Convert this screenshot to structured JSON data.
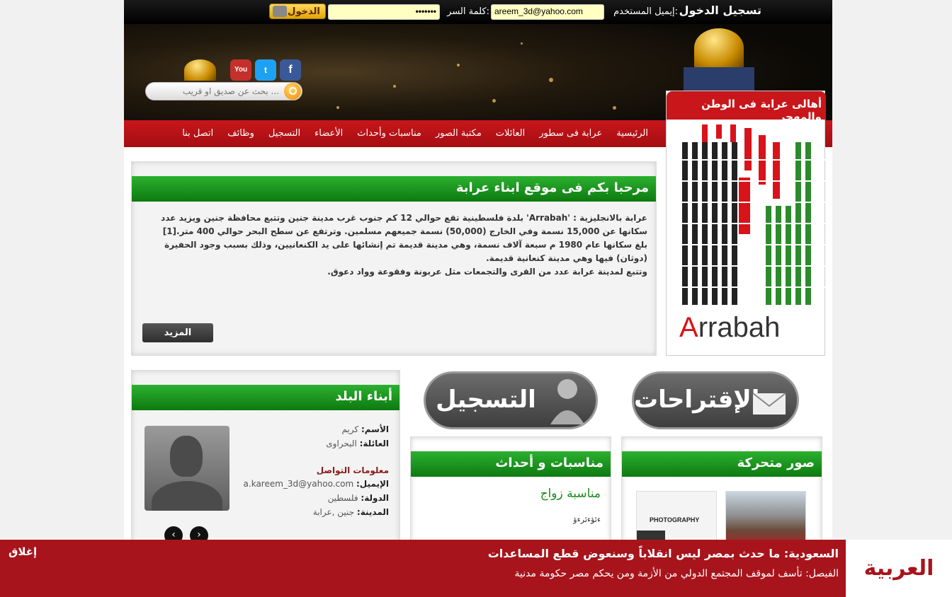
{
  "login": {
    "title": "تسجيل الدخول",
    "email_label": "إيميل المستخدم:",
    "email_value": "areem_3d@yahoo.com",
    "password_label": "كلمة السر:",
    "password_value": "•••••••",
    "submit_label": "الدخول"
  },
  "social": {
    "facebook": "f",
    "twitter": "t",
    "youtube": "You"
  },
  "search": {
    "placeholder": "بحث عن صديق او قريب ..."
  },
  "nav": {
    "items": [
      "الرئيسية",
      "عرابة فى سطور",
      "العائلات",
      "مكتبة الصور",
      "مناسبات وأحداث",
      "الأعضاء",
      "التسجيل",
      "وظائف",
      "اتصل بنا"
    ]
  },
  "logo_box": {
    "title": "أهالى عرابة فى الوطن والمهجر",
    "word_a": "A",
    "word_rest": "rrabah"
  },
  "welcome": {
    "title": "مرحبا بكم فى موقع ابناء عرابة",
    "line1": "عرابة بالانجليزية : 'Arrabah' بلدة فلسطينية تقع حوالي 12 كم جنوب غرب مدينة جنين وتتبع محافظة جنين ويزيد عدد سكانها عن 15,000 نسمة وفي الخارج (50,000) نسمة جميعهم مسلمين. وترتفع عن سطح البحر حوالي 400 متر.[1]",
    "line2": "بلغ سكانها عام 1980 م سبعة آلاف نسمة، وهي مدينة قديمة تم إنشائها على يد الكنعانيين، وذلك بسبب وجود الحفيرة (دوثان) فيها وهي مدينة كنعانية قديمة.",
    "line3": "وتتبع لمدينة عرابة عدد من القرى والتجمعات مثل عربونة وفقوعة وواد دعوق.",
    "more_label": "المزيد"
  },
  "members": {
    "title": "أبناء البلد",
    "name_label": "الأسم:",
    "name_value": "كريم",
    "family_label": "العائلة:",
    "family_value": "البحراوى",
    "contact_heading": "معلومات التواصل",
    "email_label": "الإيميل:",
    "email_value": "a.kareem_3d@yahoo.com",
    "country_label": "الدولة:",
    "country_value": "فلسطين",
    "city_label": "المدينة:",
    "city_value": "جنين ,عرابة"
  },
  "register_btn": "التسجيل",
  "suggest_btn": "الإقتراحات",
  "events": {
    "title": "مناسبات و أحداث",
    "item_title": "مناسبة زواج",
    "item_sub": "ءئؤءئرءؤ"
  },
  "photos": {
    "title": "صور متحركة",
    "tile1_text": "PHOTOGRAPHY"
  },
  "ticker": {
    "brand": "العربية",
    "headline": "السعودية: ما حدث بمصر ليس انقلاباً وسنعوض قطع المساعدات",
    "sub": "الفيصل: تأسف لموقف المجتمع الدولي من الأزمة ومن يحكم مصر حكومة مدنية",
    "close": "إغلاق"
  },
  "colors": {
    "nav_red": "#c8161b",
    "green_bar": "#1c9a20",
    "ticker_red": "#a8141b"
  }
}
